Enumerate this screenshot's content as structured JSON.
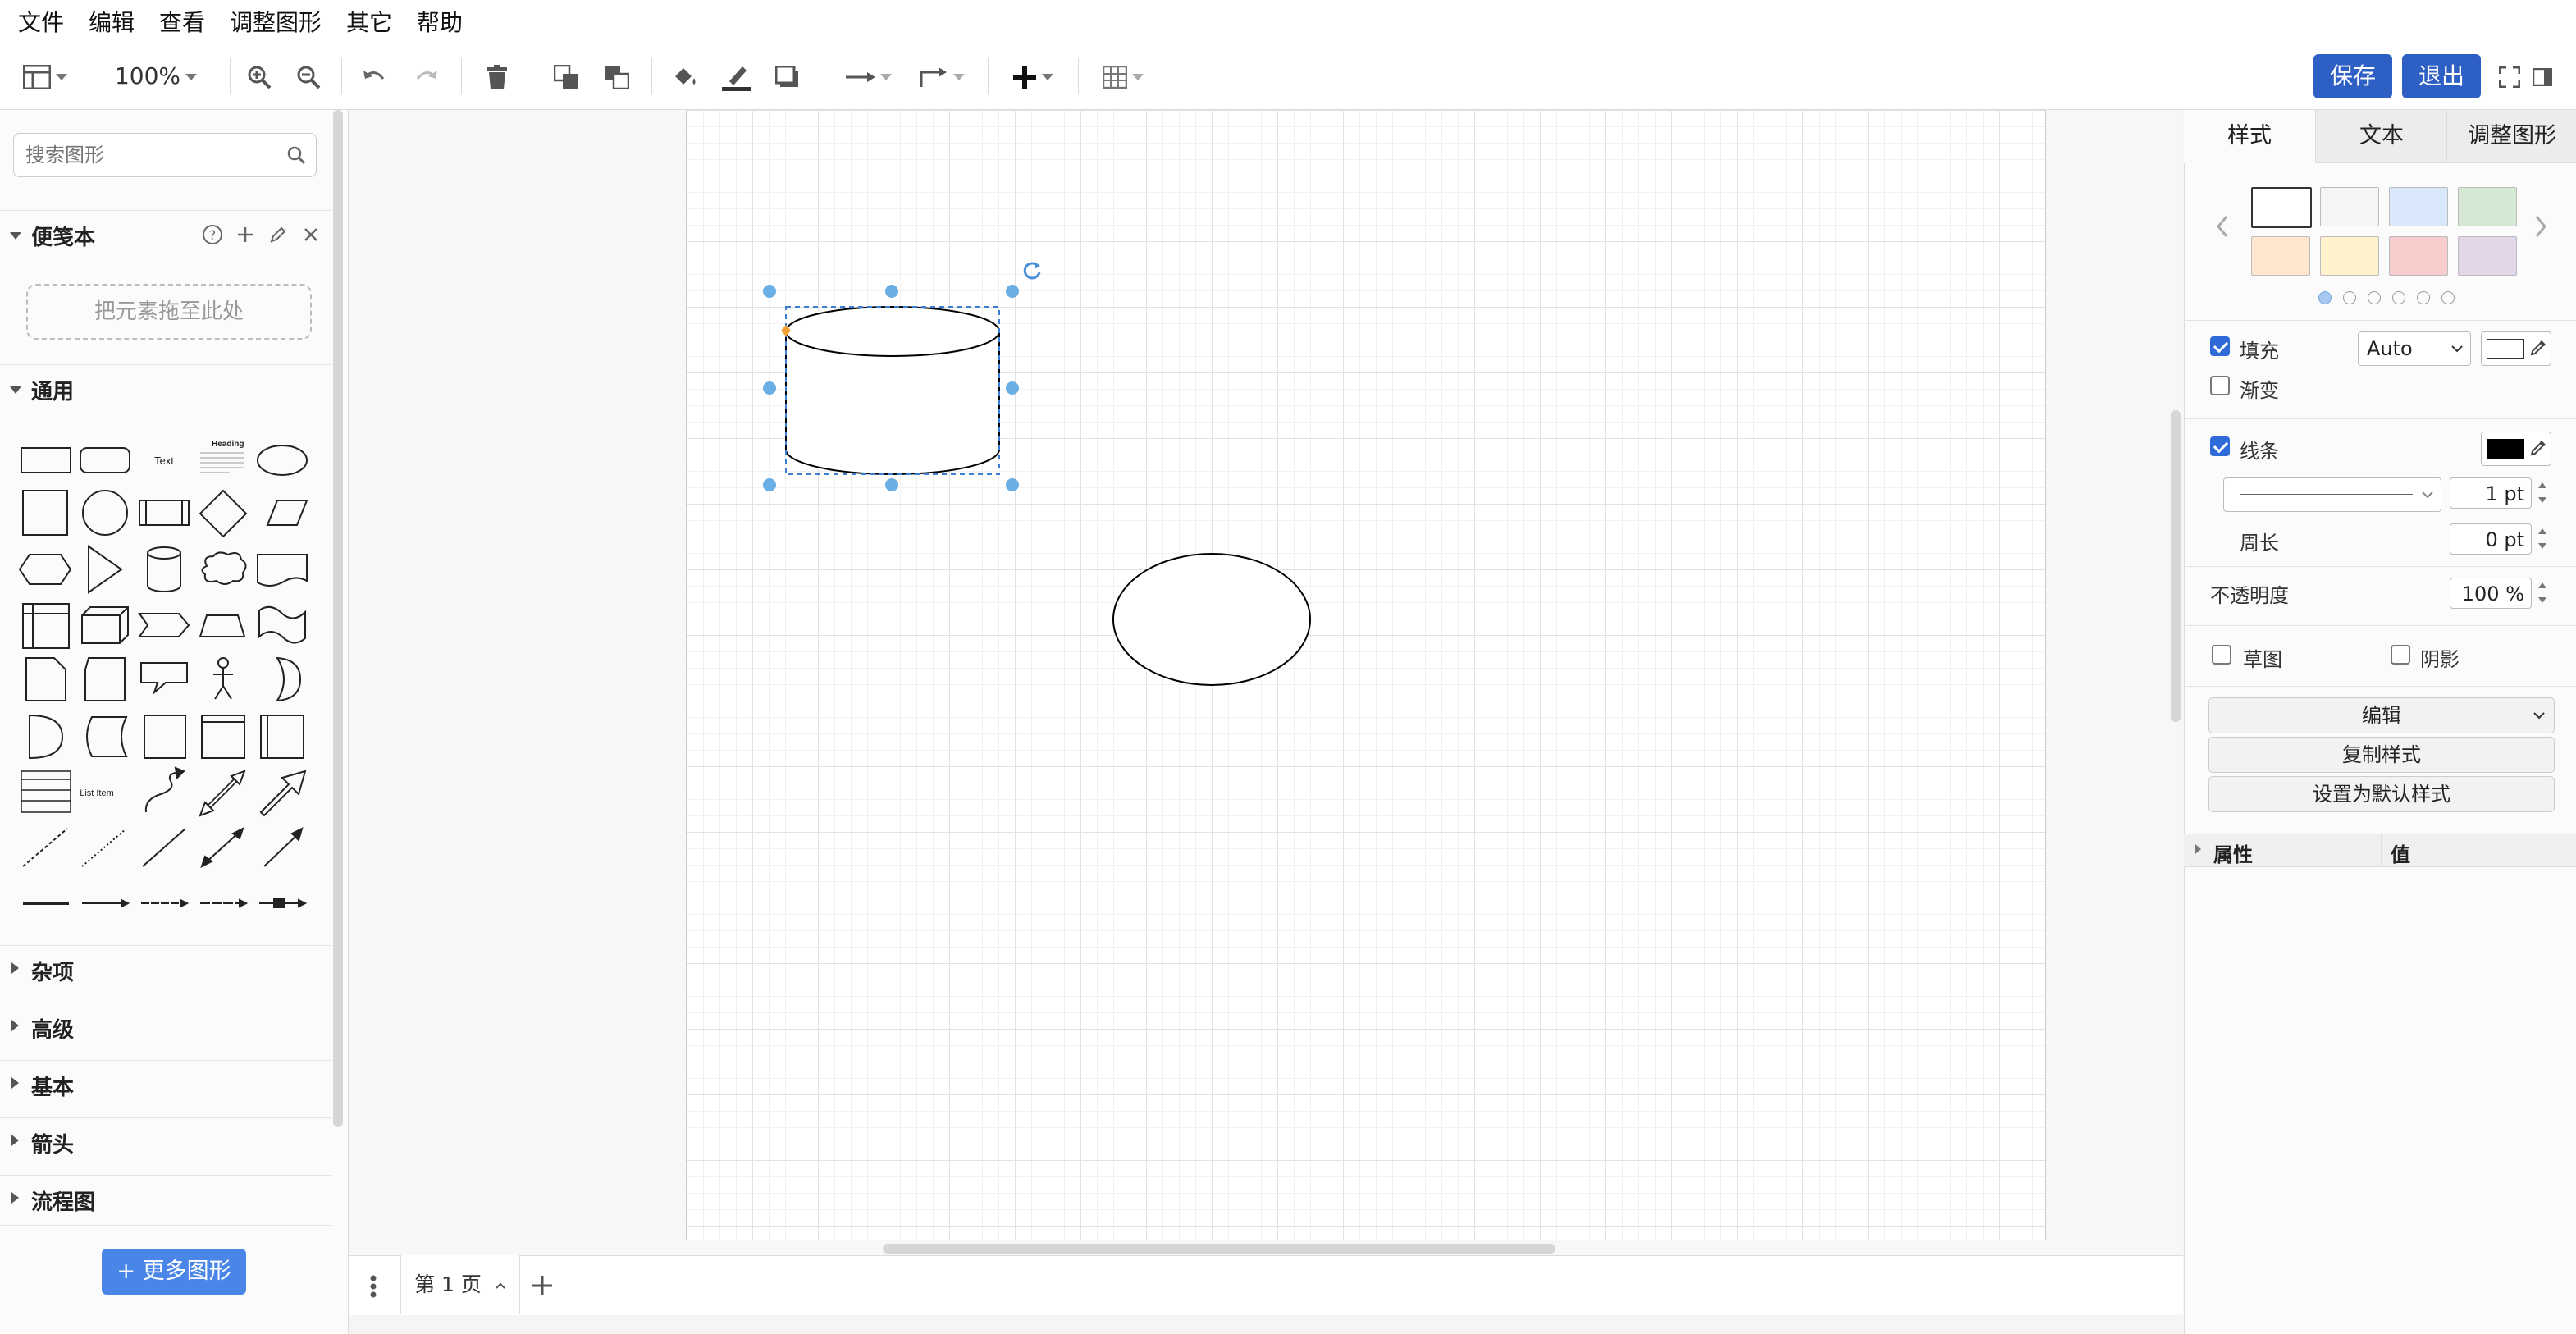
{
  "menu": [
    "文件",
    "编辑",
    "查看",
    "调整图形",
    "其它",
    "帮助"
  ],
  "toolbar": {
    "zoom": "100%",
    "save_label": "保存",
    "exit_label": "退出"
  },
  "sidebar": {
    "search_placeholder": "搜索图形",
    "scratchpad_title": "便笺本",
    "dropzone_text": "把元素拖至此处",
    "general_title": "通用",
    "shape_text_label": "Text",
    "shape_heading_label": "Heading",
    "shape_list_label": "List Item",
    "collapsed_sections": [
      "杂项",
      "高级",
      "基本",
      "箭头",
      "流程图"
    ],
    "more_shapes_label": "+ 更多图形"
  },
  "pages": {
    "current_tab": "第 1 页"
  },
  "format_panel": {
    "tabs": [
      "样式",
      "文本",
      "调整图形"
    ],
    "swatch_colors": [
      "#ffffff",
      "#f5f5f5",
      "#dae8fc",
      "#d5e8d4",
      "#ffe6cc",
      "#fff2cc",
      "#f8cecc",
      "#e1d5e7"
    ],
    "fill_label": "填充",
    "fill_checked": true,
    "fill_mode": "Auto",
    "fill_color": "#ffffff",
    "gradient_label": "渐变",
    "gradient_checked": false,
    "line_label": "线条",
    "line_checked": true,
    "line_color": "#000000",
    "line_width": "1 pt",
    "perimeter_label": "周长",
    "perimeter_value": "0 pt",
    "opacity_label": "不透明度",
    "opacity_value": "100 %",
    "sketch_label": "草图",
    "sketch_checked": false,
    "shadow_label": "阴影",
    "shadow_checked": false,
    "edit_label": "编辑",
    "copy_style_label": "复制样式",
    "set_default_label": "设置为默认样式",
    "props_header": "属性",
    "value_header": "值"
  }
}
